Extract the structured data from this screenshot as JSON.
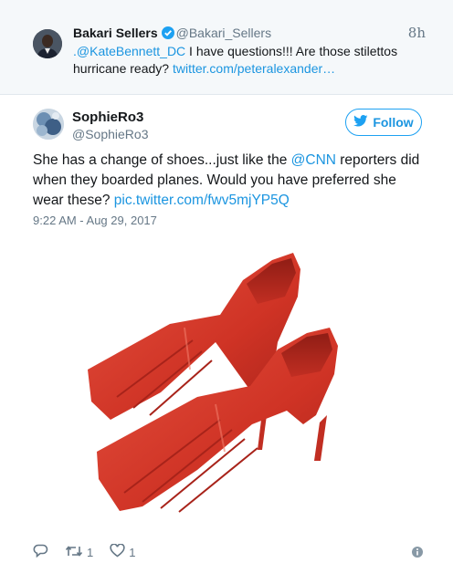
{
  "parent_tweet": {
    "author_name": "Bakari Sellers",
    "author_handle": "@Bakari_Sellers",
    "time_ago": "8h",
    "text_mention": ".@KateBennett_DC",
    "text_body": " I have questions!!! Are those stilettos hurricane ready? ",
    "text_link": "twitter.com/peteralexander…",
    "verified": true
  },
  "tweet": {
    "author_name": "SophieRo3",
    "author_handle": "@SophieRo3",
    "follow_label": "Follow",
    "text_before": "She has a change of shoes...just like the ",
    "text_mention": "@CNN",
    "text_middle": " reporters did when they boarded planes. Would you have preferred she wear these? ",
    "text_link": "pic.twitter.com/fwv5mjYP5Q",
    "timestamp": "9:22 AM - Aug 29, 2017",
    "retweet_count": "1",
    "like_count": "1"
  },
  "icons": {
    "reply": "reply-icon",
    "retweet": "retweet-icon",
    "like": "heart-icon",
    "info": "info-icon",
    "follow": "twitter-bird-icon",
    "verified": "verified-badge-icon"
  },
  "colors": {
    "link": "#1b95e0",
    "follow_border": "#1da1f2",
    "secondary_text": "#657786",
    "parent_background": "#f5f8fa",
    "shoe_red": "#d8392b"
  }
}
